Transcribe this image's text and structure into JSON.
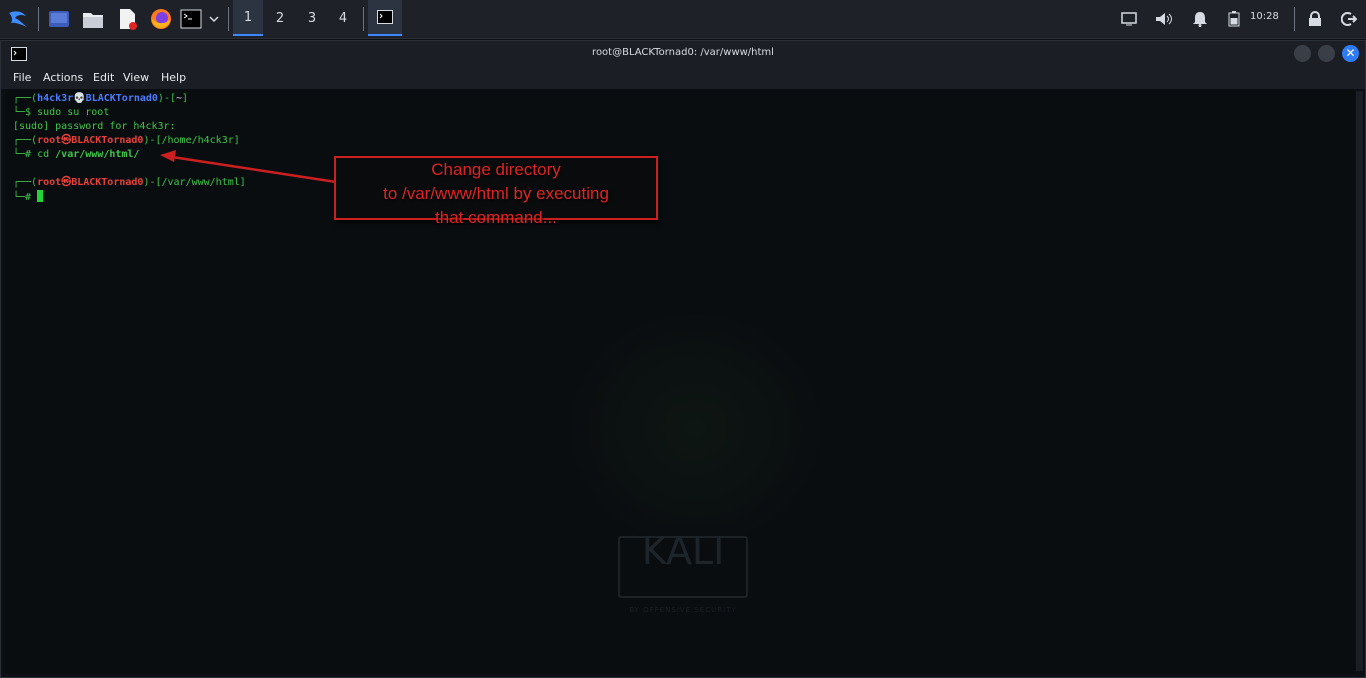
{
  "taskbar": {
    "workspaces": [
      "1",
      "2",
      "3",
      "4"
    ],
    "active_workspace": "1",
    "clock": "10:28",
    "icons": [
      "kali-menu-icon",
      "desktop-icon",
      "file-manager-icon",
      "text-editor-icon",
      "firefox-icon",
      "terminal-icon",
      "chevron-down-icon",
      "display-icon",
      "volume-icon",
      "bell-icon",
      "battery-icon",
      "lock-icon",
      "logout-icon"
    ]
  },
  "window": {
    "title": "root@BLACKTornad0: /var/www/html",
    "menu": [
      "File",
      "Actions",
      "Edit",
      "View",
      "Help"
    ]
  },
  "terminal": {
    "lines": [
      {
        "prefix": "┌──(",
        "user": "h4ck3r",
        "sep": "💀",
        "host": "BLACKTornad0",
        "mid": ")-[",
        "path": "~",
        "end": "]"
      },
      {
        "prompt": "└─$ ",
        "cmd": "sudo su root"
      },
      {
        "text": "[sudo] password for h4ck3r:"
      },
      {
        "prefix": "┌──(",
        "user": "root",
        "sep": "㉿",
        "host": "BLACKTornad0",
        "mid": ")-[",
        "path": "/home/h4ck3r",
        "end": "]"
      },
      {
        "prompt": "└─# ",
        "cmd_a": "cd ",
        "cmd_b": "/var/www/html/"
      },
      {
        "prefix": "┌──(",
        "user": "root",
        "sep": "㉿",
        "host": "BLACKTornad0",
        "mid": ")-[",
        "path": "/var/www/html",
        "end": "]"
      },
      {
        "prompt": "└─# "
      }
    ]
  },
  "watermark": {
    "logo": "KALI",
    "sub": "BY OFFENSIVE SECURITY"
  },
  "annotation": {
    "line1": "Change directory",
    "line2": "to /var/www/html by executing",
    "line3": "that command..."
  },
  "colors": {
    "accent": "#3d86ff",
    "prompt_green": "#3ec64a",
    "root_red": "#e8413a",
    "user_blue": "#4d7cff",
    "annotation_red": "#e02424"
  }
}
